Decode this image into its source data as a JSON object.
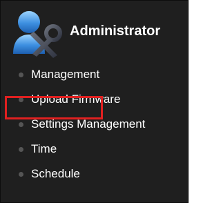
{
  "header": {
    "title": "Administrator",
    "icon": "admin-tools-icon"
  },
  "menu": {
    "items": [
      {
        "label": "Management"
      },
      {
        "label": "Upload Firmware"
      },
      {
        "label": "Settings Management"
      },
      {
        "label": "Time",
        "highlighted": true
      },
      {
        "label": "Schedule"
      }
    ]
  },
  "colors": {
    "background": "#1f1f1f",
    "text": "#ffffff",
    "bullet": "#555555",
    "highlight": "#e02020"
  }
}
